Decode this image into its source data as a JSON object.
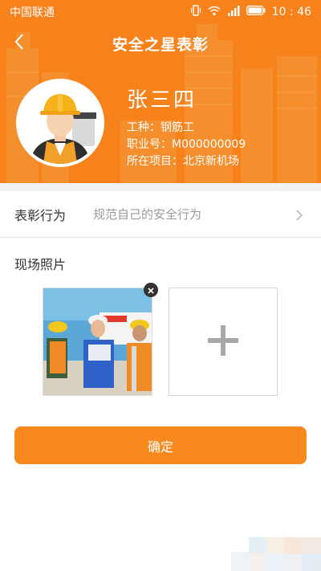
{
  "status_bar": {
    "carrier": "中国联通",
    "time": "10 : 46"
  },
  "header": {
    "title": "安全之星表彰"
  },
  "profile": {
    "name": "张三四",
    "job_label": "工种",
    "job_value": "钢筋工",
    "job_line": "工种：钢筋工",
    "id_line": "职业号：M000000009",
    "project_line": "所在项目：北京新机场"
  },
  "form": {
    "praise_label": "表彰行为",
    "praise_value": "规范自己的安全行为",
    "photos_label": "现场照片"
  },
  "actions": {
    "confirm_label": "确定"
  },
  "colors": {
    "brand": "#f7821b",
    "button": "#f8891f"
  },
  "icons": [
    "back-arrow-icon",
    "battery-icon",
    "wifi-icon",
    "signal-icon",
    "vibrate-icon",
    "chevron-right-icon",
    "close-icon",
    "plus-icon"
  ]
}
